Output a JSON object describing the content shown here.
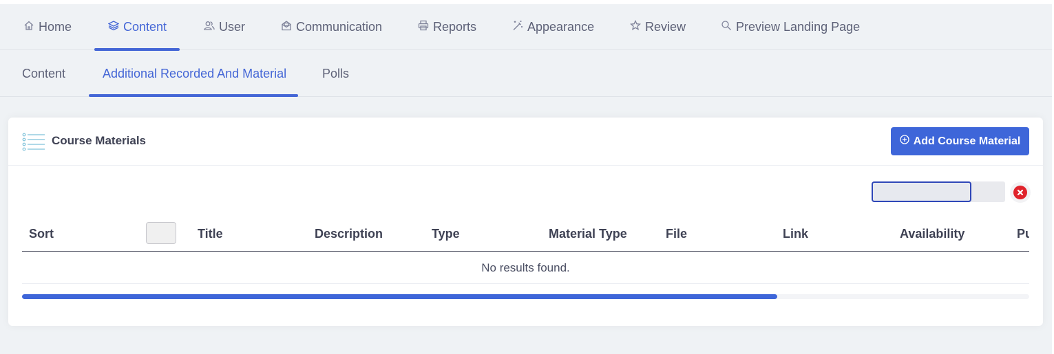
{
  "main_nav": {
    "items": [
      {
        "label": "Home",
        "icon": "home-icon"
      },
      {
        "label": "Content",
        "icon": "layers-icon",
        "active": true
      },
      {
        "label": "User",
        "icon": "users-icon"
      },
      {
        "label": "Communication",
        "icon": "envelope-icon"
      },
      {
        "label": "Reports",
        "icon": "printer-icon"
      },
      {
        "label": "Appearance",
        "icon": "magic-wand-icon"
      },
      {
        "label": "Review",
        "icon": "star-icon"
      },
      {
        "label": "Preview Landing Page",
        "icon": "search-icon"
      }
    ]
  },
  "sub_nav": {
    "items": [
      {
        "label": "Content"
      },
      {
        "label": "Additional Recorded And Material",
        "active": true
      },
      {
        "label": "Polls"
      }
    ]
  },
  "card": {
    "title": "Course Materials",
    "title_icon": "list-icon",
    "add_button_label": "Add Course Material",
    "add_button_icon": "plus-circle-icon"
  },
  "search": {
    "value": "",
    "clear_icon": "close-circle-icon"
  },
  "table": {
    "columns": [
      "Sort",
      "Title",
      "Description",
      "Type",
      "Material Type",
      "File",
      "Link",
      "Availability",
      "Pu"
    ],
    "empty_message": "No results found.",
    "horizontal_scroll_fraction": 0.75
  },
  "colors": {
    "accent": "#4466d6",
    "button": "#3e66d9",
    "clear_button": "#e0232b",
    "background": "#eff2f5"
  }
}
